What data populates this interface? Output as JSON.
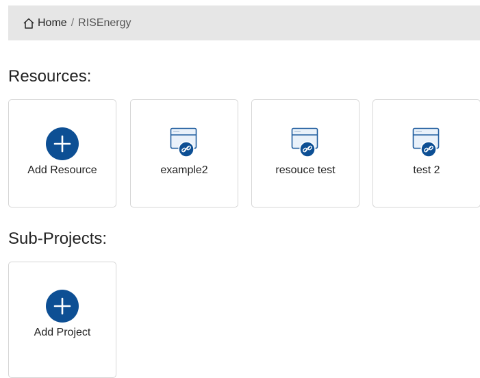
{
  "breadcrumb": {
    "home_label": "Home",
    "separator": "/",
    "current": "RISEnergy"
  },
  "resources": {
    "title": "Resources:",
    "add_label": "Add Resource",
    "items": [
      {
        "label": "example2",
        "icon": "web-link-icon"
      },
      {
        "label": "resouce test",
        "icon": "web-link-icon"
      },
      {
        "label": "test 2",
        "icon": "web-link-icon"
      }
    ]
  },
  "subprojects": {
    "title": "Sub-Projects:",
    "add_label": "Add Project"
  },
  "colors": {
    "accent": "#0d4f94",
    "breadcrumb_bg": "#e6e6e6",
    "card_border": "#d5d5d5"
  }
}
